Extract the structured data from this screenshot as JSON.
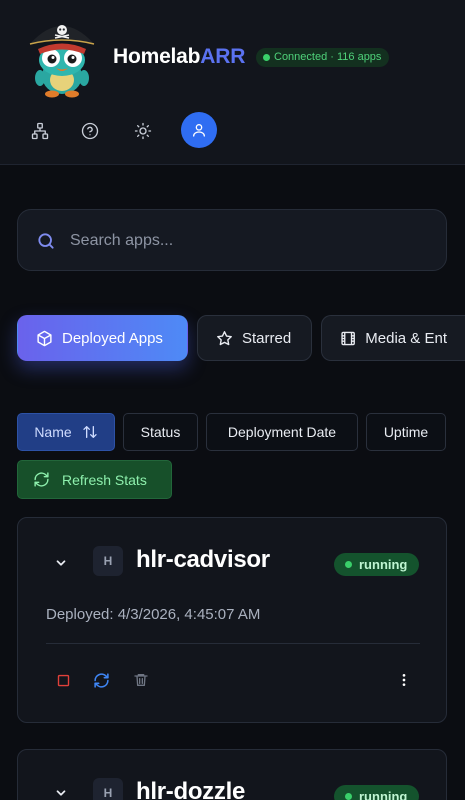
{
  "header": {
    "brand_prefix": "Homelab",
    "brand_suffix": "ARR",
    "brand_accent_color": "#5b72f0",
    "connection_status": "Connected · 116 apps",
    "icons": [
      "network-icon",
      "help-icon",
      "theme-sun-icon",
      "user-icon"
    ]
  },
  "search": {
    "placeholder": "Search apps...",
    "value": ""
  },
  "categories": [
    {
      "label": "Deployed Apps",
      "icon": "cube-icon",
      "active": true
    },
    {
      "label": "Starred",
      "icon": "star-icon",
      "active": false
    },
    {
      "label": "Media & Ent",
      "icon": "film-icon",
      "active": false
    }
  ],
  "sort": {
    "options": [
      "Name",
      "Status",
      "Deployment Date",
      "Uptime"
    ],
    "active": "Name"
  },
  "refresh_label": "Refresh Stats",
  "apps": [
    {
      "initial": "H",
      "name": "hlr-cadvisor",
      "status": "running",
      "deployed": "Deployed: 4/3/2026, 4:45:07 AM"
    },
    {
      "initial": "H",
      "name": "hlr-dozzle",
      "status": "running"
    }
  ]
}
